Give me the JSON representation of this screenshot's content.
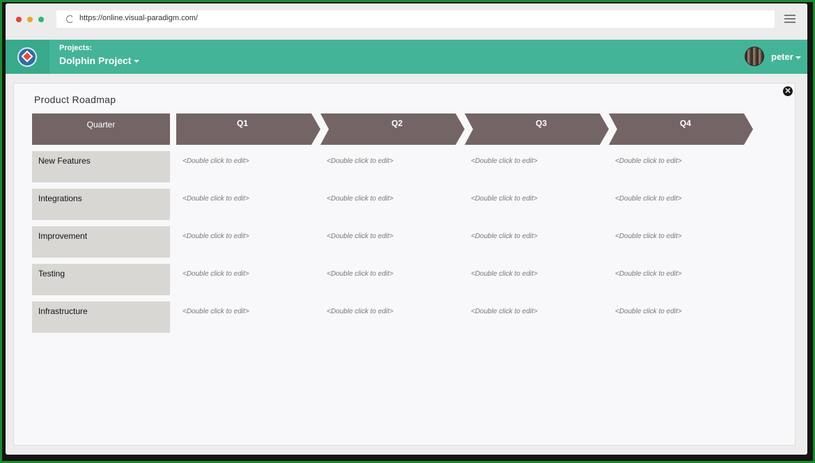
{
  "browser": {
    "url": "https://online.visual-paradigm.com/"
  },
  "header": {
    "projects_label": "Projects:",
    "project_name": "Dolphin Project",
    "user_name": "peter"
  },
  "roadmap": {
    "title": "Product Roadmap",
    "corner_label": "Quarter",
    "quarters": [
      "Q1",
      "Q2",
      "Q3",
      "Q4"
    ],
    "rows": [
      {
        "label": "New Features",
        "cells": [
          "<Double click to edit>",
          "<Double click to edit>",
          "<Double click to edit>",
          "<Double click to edit>"
        ]
      },
      {
        "label": "Integrations",
        "cells": [
          "<Double click to edit>",
          "<Double click to edit>",
          "<Double click to edit>",
          "<Double click to edit>"
        ]
      },
      {
        "label": "Improvement",
        "cells": [
          "<Double click to edit>",
          "<Double click to edit>",
          "<Double click to edit>",
          "<Double click to edit>"
        ]
      },
      {
        "label": "Testing",
        "cells": [
          "<Double click to edit>",
          "<Double click to edit>",
          "<Double click to edit>",
          "<Double click to edit>"
        ]
      },
      {
        "label": "Infrastructure",
        "cells": [
          "<Double click to edit>",
          "<Double click to edit>",
          "<Double click to edit>",
          "<Double click to edit>"
        ]
      }
    ]
  },
  "colors": {
    "header_bg": "#43b497",
    "quarter_bg": "#736565",
    "row_label_bg": "#d8d7d4"
  }
}
